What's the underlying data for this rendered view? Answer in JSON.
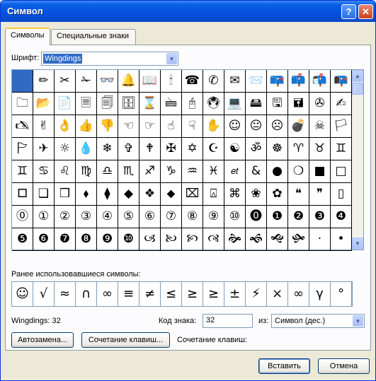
{
  "window": {
    "title": "Символ",
    "help_label": "?",
    "close_label": "✕"
  },
  "tabs": [
    {
      "label": "Символы",
      "active": true
    },
    {
      "label": "Специальные знаки",
      "active": false
    }
  ],
  "font": {
    "label": "Шрифт:",
    "value": "Wingdings"
  },
  "grid": {
    "selected_index": 0,
    "rows": [
      [
        " ",
        "✏",
        "✂",
        "✁",
        "👓",
        "🔔",
        "📖",
        "🕯",
        "☎",
        "✆",
        "✉",
        "📨",
        "📪",
        "📫",
        "📬",
        "📭"
      ],
      [
        "🗀",
        "📂",
        "📄",
        "🗏",
        "🗐",
        "🗄",
        "⌛",
        "🖮",
        "🖰",
        "🖲",
        "💻",
        "🖴",
        "🖫",
        "🖬",
        "✇",
        "✍"
      ],
      [
        "🖎",
        "✌",
        "👌",
        "👍",
        "👎",
        "☜",
        "☞",
        "☝",
        "☟",
        "✋",
        "☺",
        "😐",
        "☹",
        "💣",
        "☠",
        "🏳"
      ],
      [
        "🏱",
        "✈",
        "☼",
        "💧",
        "❄",
        "✞",
        "🕈",
        "✠",
        "✡",
        "☪",
        "☯",
        "ॐ",
        "☸",
        "♈",
        "♉",
        "♊"
      ],
      [
        "♊",
        "♋",
        "♌",
        "♍",
        "♎",
        "♏",
        "♐",
        "♑",
        "♒",
        "♓",
        "𝑒𝑡",
        "&",
        "●",
        "❍",
        "■",
        "□"
      ],
      [
        "🞐",
        "❑",
        "❒",
        "⬧",
        "⧫",
        "◆",
        "❖",
        "⬥",
        "⌧",
        "⍓",
        "⌘",
        "❀",
        "✿",
        "❝",
        "❞",
        "▯"
      ],
      [
        "⓪",
        "①",
        "②",
        "③",
        "④",
        "⑤",
        "⑥",
        "⑦",
        "⑧",
        "⑨",
        "⑩",
        "⓿",
        "❶",
        "❷",
        "❸",
        "❹"
      ],
      [
        "❺",
        "❻",
        "❼",
        "❽",
        "❾",
        "❿",
        "🙢",
        "🙠",
        "🙡",
        "🙣",
        "🙞",
        "🙜",
        "🙝",
        "🙟",
        "·",
        "•"
      ]
    ]
  },
  "recent": {
    "label": "Ранее использовавшиеся символы:",
    "symbols": [
      "☺",
      "√",
      "≈",
      "∩",
      "∞",
      "≡",
      "≠",
      "≤",
      "≥",
      "≥",
      "±",
      "⚡",
      "×",
      "∞",
      "γ",
      "°"
    ]
  },
  "status": {
    "char_name": "Wingdings: 32"
  },
  "code": {
    "label": "Код знака:",
    "value": "32"
  },
  "from": {
    "label": "из:",
    "value": "Символ (дес.)"
  },
  "buttons": {
    "autocorrect": "Автозамена...",
    "shortcut_key": "Сочетание клавиш...",
    "insert": "Вставить",
    "cancel": "Отмена"
  },
  "shortcut": {
    "label": "Сочетание клавиш:"
  }
}
